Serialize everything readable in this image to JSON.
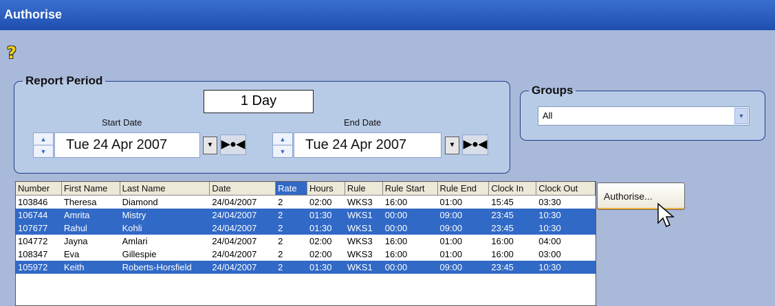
{
  "window": {
    "title": "Authorise"
  },
  "toolbar": {
    "help_icon": "question-icon",
    "help_glyph": "?"
  },
  "report_period": {
    "legend": "Report Period",
    "duration": "1 Day",
    "start_label": "Start Date",
    "start_value": "Tue 24 Apr 2007",
    "end_label": "End Date",
    "end_value": "Tue 24 Apr 2007"
  },
  "groups": {
    "legend": "Groups",
    "selected": "All"
  },
  "grid": {
    "columns": [
      "Number",
      "First Name",
      "Last Name",
      "Date",
      "Rate",
      "Hours",
      "Rule",
      "Rule Start",
      "Rule End",
      "Clock In",
      "Clock Out"
    ],
    "selected_column": "Rate",
    "rows": [
      {
        "selected": false,
        "cells": [
          "103846",
          "Theresa",
          "Diamond",
          "24/04/2007",
          "2",
          "02:00",
          "WKS3",
          "16:00",
          "01:00",
          "15:45",
          "03:30"
        ]
      },
      {
        "selected": true,
        "cells": [
          "106744",
          "Amrita",
          "Mistry",
          "24/04/2007",
          "2",
          "01:30",
          "WKS1",
          "00:00",
          "09:00",
          "23:45",
          "10:30"
        ]
      },
      {
        "selected": true,
        "cells": [
          "107677",
          "Rahul",
          "Kohli",
          "24/04/2007",
          "2",
          "01:30",
          "WKS1",
          "00:00",
          "09:00",
          "23:45",
          "10:30"
        ]
      },
      {
        "selected": false,
        "cells": [
          "104772",
          "Jayna",
          "Amlari",
          "24/04/2007",
          "2",
          "02:00",
          "WKS3",
          "16:00",
          "01:00",
          "16:00",
          "04:00"
        ]
      },
      {
        "selected": false,
        "cells": [
          "108347",
          "Eva",
          "Gillespie",
          "24/04/2007",
          "2",
          "02:00",
          "WKS3",
          "16:00",
          "01:00",
          "16:00",
          "03:00"
        ]
      },
      {
        "selected": true,
        "cells": [
          "105972",
          "Keith",
          "Roberts-Horsfield",
          "24/04/2007",
          "2",
          "01:30",
          "WKS1",
          "00:00",
          "09:00",
          "23:45",
          "10:30"
        ]
      }
    ]
  },
  "actions": {
    "authorise_label": "Authorise..."
  },
  "colors": {
    "title_bar": "#2458c0",
    "selection": "#3169c6",
    "background": "#a9b9d9"
  }
}
